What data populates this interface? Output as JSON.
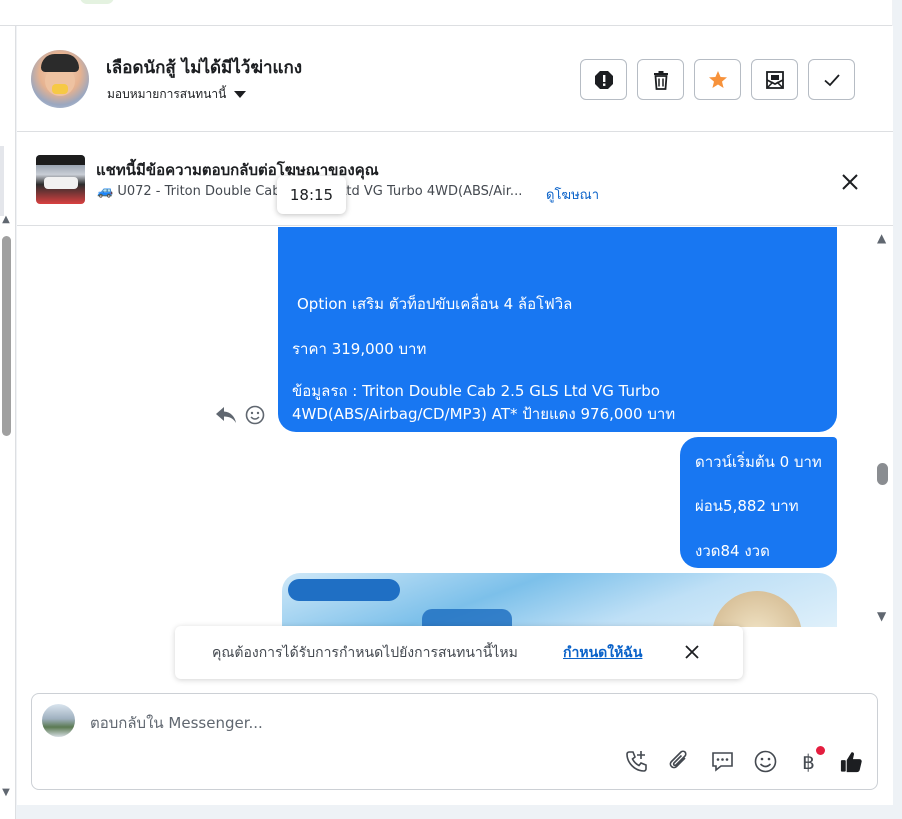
{
  "header": {
    "contact_name": "เลือดนักสู้ ไม่ได้มีไว้ฆ่าแกง",
    "assign_label": "มอบหมายการสนทนานี้",
    "actions": [
      "report",
      "delete",
      "star",
      "mark-unread",
      "done"
    ]
  },
  "ad_reply": {
    "title": "แชทนี้มีข้อความตอบกลับต่อโฆษณาของคุณ",
    "subtitle": "🚙 U072 - Triton Double Cab 2.5 GLS Ltd VG Turbo 4WD(ABS/Air...",
    "view_ad_link": "ดูโฆษณา",
    "tooltip_time": "18:15"
  },
  "messages": {
    "incoming": {
      "line1": " Option เสริม ตัวท็อปขับเคลื่อน 4 ล้อโฟวิล",
      "line2": "ราคา 319,000 บาท",
      "line3": "ข้อมูลรถ : Triton Double Cab 2.5 GLS Ltd VG Turbo 4WD(ABS/Airbag/CD/MP3) AT* ป้ายแดง 976,000 บาท"
    },
    "outgoing": {
      "line1": "ดาวน์เริ่มต้น 0 บาท",
      "line2": "ผ่อน5,882 บาท",
      "line3": "งวด84 งวด"
    }
  },
  "assign_prompt": {
    "question": "คุณต้องการได้รับการกำหนดไปยังการสนทนานี้ไหม",
    "action": "กำหนดให้ฉัน"
  },
  "composer": {
    "placeholder": "ตอบกลับใน Messenger...",
    "tools": [
      "call-add-icon",
      "attachment-icon",
      "saved-reply-icon",
      "emoji-icon",
      "payment-icon",
      "like-icon"
    ],
    "payment_symbol": "฿"
  },
  "colors": {
    "accent": "#1877f2",
    "link": "#0a62c9",
    "star": "#f7923b",
    "notification": "#e41e3f"
  }
}
